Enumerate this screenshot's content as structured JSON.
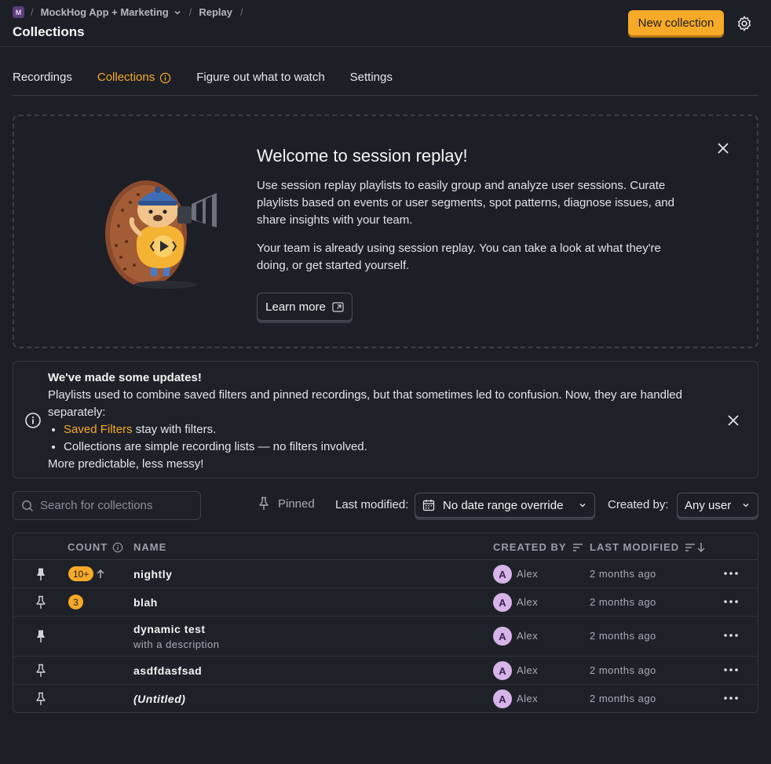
{
  "breadcrumb": {
    "org_badge": "M",
    "project": "MockHog App + Marketing",
    "section": "Replay"
  },
  "page_title": "Collections",
  "header": {
    "new_button": "New collection"
  },
  "tabs": [
    {
      "label": "Recordings"
    },
    {
      "label": "Collections"
    },
    {
      "label": "Figure out what to watch"
    },
    {
      "label": "Settings"
    }
  ],
  "welcome": {
    "title": "Welcome to session replay!",
    "paragraph1": "Use session replay playlists to easily group and analyze user sessions. Curate playlists based on events or user segments, spot patterns, diagnose issues, and share insights with your team.",
    "paragraph2": "Your team is already using session replay. You can take a look at what they're doing, or get started yourself.",
    "learn_more": "Learn more"
  },
  "notice": {
    "title": "We've made some updates!",
    "body": "Playlists used to combine saved filters and pinned recordings, but that sometimes led to confusion. Now, they are handled separately:",
    "bullet1_link": "Saved Filters",
    "bullet1_rest": " stay with filters.",
    "bullet2": "Collections are simple recording lists — no filters involved.",
    "footer": "More predictable, less messy!"
  },
  "filters": {
    "search_placeholder": "Search for collections",
    "pinned_label": "Pinned",
    "last_modified_label": "Last modified:",
    "date_range_value": "No date range override",
    "created_by_label": "Created by:",
    "created_by_value": "Any user"
  },
  "table": {
    "columns": {
      "count": "COUNT",
      "name": "NAME",
      "created_by": "CREATED BY",
      "last_modified": "LAST MODIFIED"
    },
    "rows": [
      {
        "pinned": true,
        "count": "10+",
        "name": "nightly",
        "description": "",
        "avatar": "A",
        "creator": "Alex",
        "modified": "2 months ago"
      },
      {
        "pinned": false,
        "count": "3",
        "name": "blah",
        "description": "",
        "avatar": "A",
        "creator": "Alex",
        "modified": "2 months ago"
      },
      {
        "pinned": true,
        "count": "",
        "name": "dynamic test",
        "description": "with a description",
        "avatar": "A",
        "creator": "Alex",
        "modified": "2 months ago"
      },
      {
        "pinned": false,
        "count": "",
        "name": "asdfdasfsad",
        "description": "",
        "avatar": "A",
        "creator": "Alex",
        "modified": "2 months ago"
      },
      {
        "pinned": false,
        "count": "",
        "name": "(Untitled)",
        "description": "",
        "avatar": "A",
        "creator": "Alex",
        "modified": "2 months ago"
      }
    ]
  },
  "colors": {
    "accent": "#f7a928",
    "background": "#1d1f27",
    "avatar_bg": "#d7b4e8"
  },
  "icons": [
    "chevron-down-icon",
    "gear-icon",
    "info-icon",
    "close-icon",
    "external-link-icon",
    "search-icon",
    "pin-icon",
    "calendar-icon",
    "sort-icon",
    "sort-desc-icon",
    "arrow-up-icon",
    "more-icon"
  ]
}
